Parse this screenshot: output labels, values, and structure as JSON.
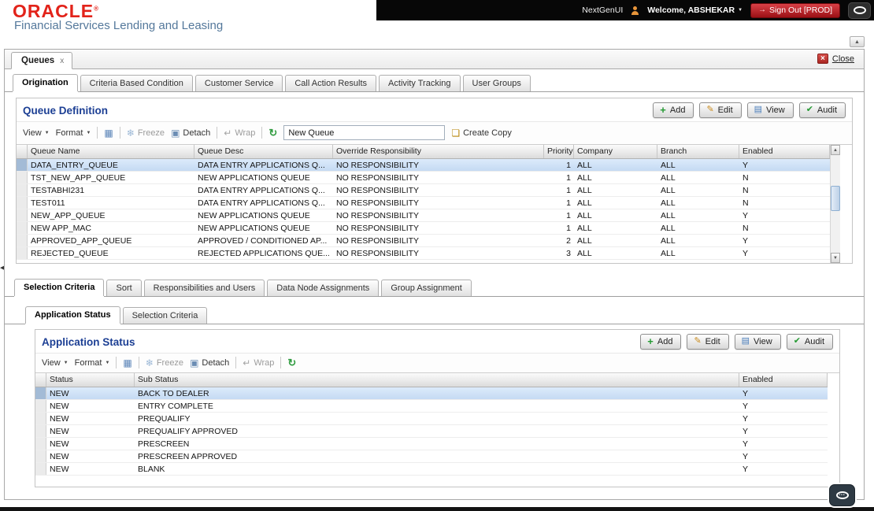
{
  "header": {
    "logo": "ORACLE",
    "registered": "®",
    "subtitle": "Financial Services Lending and Leasing",
    "topbar": {
      "nextgen_label": "NextGenUI",
      "welcome_label": "Welcome, ABSHEKAR",
      "signout_label": "Sign Out [PROD]"
    }
  },
  "window": {
    "tab_label": "Queues",
    "tab_close": "x",
    "close_label": "Close"
  },
  "main_tabs": [
    {
      "label": "Origination",
      "active": true
    },
    {
      "label": "Criteria Based Condition",
      "active": false
    },
    {
      "label": "Customer Service",
      "active": false
    },
    {
      "label": "Call Action Results",
      "active": false
    },
    {
      "label": "Activity Tracking",
      "active": false
    },
    {
      "label": "User Groups",
      "active": false
    }
  ],
  "queue_definition": {
    "title": "Queue Definition",
    "buttons": {
      "add": "Add",
      "edit": "Edit",
      "view": "View",
      "audit": "Audit"
    },
    "toolbar": {
      "view": "View",
      "format": "Format",
      "freeze": "Freeze",
      "detach": "Detach",
      "wrap": "Wrap",
      "search_value": "New Queue",
      "create_copy": "Create Copy"
    },
    "columns": [
      "Queue Name",
      "Queue Desc",
      "Override Responsibility",
      "Priority",
      "Company",
      "Branch",
      "Enabled"
    ],
    "rows": [
      [
        "DATA_ENTRY_QUEUE",
        "DATA ENTRY APPLICATIONS Q...",
        "NO RESPONSIBILITY",
        "1",
        "ALL",
        "ALL",
        "Y"
      ],
      [
        "TST_NEW_APP_QUEUE",
        "NEW APPLICATIONS QUEUE",
        "NO RESPONSIBILITY",
        "1",
        "ALL",
        "ALL",
        "N"
      ],
      [
        "TESTABHI231",
        "DATA ENTRY APPLICATIONS Q...",
        "NO RESPONSIBILITY",
        "1",
        "ALL",
        "ALL",
        "N"
      ],
      [
        "TEST011",
        "DATA ENTRY APPLICATIONS Q...",
        "NO RESPONSIBILITY",
        "1",
        "ALL",
        "ALL",
        "N"
      ],
      [
        "NEW_APP_QUEUE",
        "NEW APPLICATIONS QUEUE",
        "NO RESPONSIBILITY",
        "1",
        "ALL",
        "ALL",
        "Y"
      ],
      [
        "NEW APP_MAC",
        "NEW APPLICATIONS QUEUE",
        "NO RESPONSIBILITY",
        "1",
        "ALL",
        "ALL",
        "N"
      ],
      [
        "APPROVED_APP_QUEUE",
        "APPROVED / CONDITIONED AP...",
        "NO RESPONSIBILITY",
        "2",
        "ALL",
        "ALL",
        "Y"
      ],
      [
        "REJECTED_QUEUE",
        "REJECTED APPLICATIONS QUE...",
        "NO RESPONSIBILITY",
        "3",
        "ALL",
        "ALL",
        "Y"
      ]
    ]
  },
  "selection_tabs": [
    {
      "label": "Selection Criteria",
      "active": true
    },
    {
      "label": "Sort",
      "active": false
    },
    {
      "label": "Responsibilities and Users",
      "active": false
    },
    {
      "label": "Data Node Assignments",
      "active": false
    },
    {
      "label": "Group Assignment",
      "active": false
    }
  ],
  "sub_tabs": [
    {
      "label": "Application Status",
      "active": true
    },
    {
      "label": "Selection Criteria",
      "active": false
    }
  ],
  "application_status": {
    "title": "Application Status",
    "buttons": {
      "add": "Add",
      "edit": "Edit",
      "view": "View",
      "audit": "Audit"
    },
    "toolbar": {
      "view": "View",
      "format": "Format",
      "freeze": "Freeze",
      "detach": "Detach",
      "wrap": "Wrap"
    },
    "columns": [
      "Status",
      "Sub Status",
      "Enabled"
    ],
    "rows": [
      [
        "NEW",
        "BACK TO DEALER",
        "Y"
      ],
      [
        "NEW",
        "ENTRY COMPLETE",
        "Y"
      ],
      [
        "NEW",
        "PREQUALIFY",
        "Y"
      ],
      [
        "NEW",
        "PREQUALIFY APPROVED",
        "Y"
      ],
      [
        "NEW",
        "PRESCREEN",
        "Y"
      ],
      [
        "NEW",
        "PRESCREEN APPROVED",
        "Y"
      ],
      [
        "NEW",
        "BLANK",
        "Y"
      ]
    ]
  },
  "icons": {
    "add": "+",
    "edit": "✎",
    "view": "▤",
    "audit": "✔",
    "grid": "▦",
    "freeze": "❄",
    "detach": "▣",
    "wrap": "↵",
    "refresh": "↻",
    "copy": "❏",
    "caret": "▼",
    "up_arrow": "▲",
    "down_arrow": "▼",
    "close_x": "×",
    "signout_arrow": "→",
    "collapse_left": "◀",
    "chat_dots": "•••"
  },
  "colors": {
    "oracle_red": "#e2231a",
    "title_blue": "#1c3f94",
    "selected_row": "#c9dcf3",
    "signout_red": "#9c1116",
    "topbar_black": "#070707"
  }
}
